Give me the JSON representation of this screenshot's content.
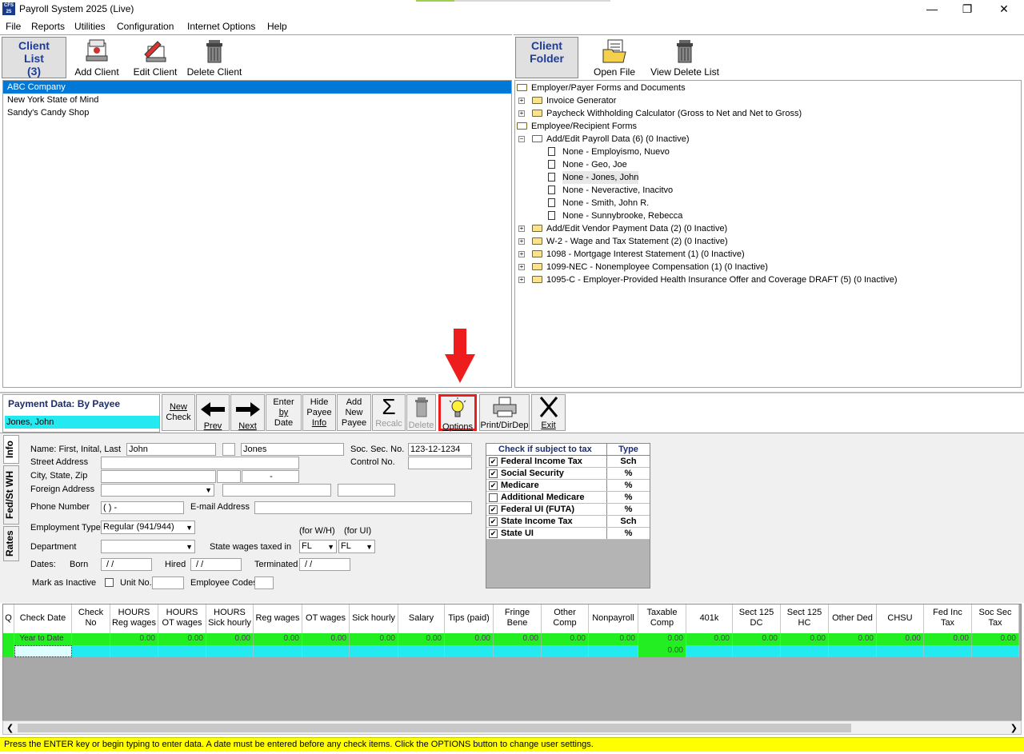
{
  "window": {
    "title": "Payroll System 2025 (Live)",
    "icon_label": "CFS 25"
  },
  "menu": [
    "File",
    "Reports",
    "Utilities",
    "Configuration",
    "Internet Options",
    "Help"
  ],
  "client_toolbar": {
    "client_list_label": "Client List (3)",
    "client_list_l1": "Client",
    "client_list_l2": "List",
    "client_list_l3": "(3)",
    "add_client": "Add Client",
    "edit_client": "Edit Client",
    "delete_client": "Delete Client"
  },
  "folder_toolbar": {
    "client_folder_l1": "Client",
    "client_folder_l2": "Folder",
    "open_file": "Open File",
    "view_delete_list": "View Delete List"
  },
  "clients": [
    "ABC Company",
    "New York State of Mind",
    "Sandy's Candy Shop"
  ],
  "tree": [
    {
      "level": 0,
      "type": "open-folder",
      "label": "Employer/Payer Forms and Documents"
    },
    {
      "level": 1,
      "type": "folder",
      "label": "Invoice Generator"
    },
    {
      "level": 1,
      "type": "folder",
      "label": "Paycheck Withholding Calculator (Gross to Net and Net to Gross)"
    },
    {
      "level": 0,
      "type": "open-folder",
      "label": "Employee/Recipient Forms"
    },
    {
      "level": 1,
      "type": "open-folder",
      "label": "Add/Edit Payroll Data  (6) (0 Inactive)"
    },
    {
      "level": 2,
      "type": "doc",
      "label": "None - Employismo, Nuevo"
    },
    {
      "level": 2,
      "type": "doc",
      "label": "None - Geo, Joe"
    },
    {
      "level": 2,
      "type": "doc",
      "label": "None - Jones, John"
    },
    {
      "level": 2,
      "type": "doc",
      "label": "None - Neveractive, Inacitvo"
    },
    {
      "level": 2,
      "type": "doc",
      "label": "None - Smith, John R."
    },
    {
      "level": 2,
      "type": "doc",
      "label": "None - Sunnybrooke, Rebecca"
    },
    {
      "level": 1,
      "type": "folder",
      "label": "Add/Edit Vendor Payment Data  (2) (0 Inactive)"
    },
    {
      "level": 1,
      "type": "folder",
      "label": "W-2 - Wage and Tax Statement  (2) (0 Inactive)"
    },
    {
      "level": 1,
      "type": "folder",
      "label": "1098 - Mortgage Interest Statement  (1) (0 Inactive)"
    },
    {
      "level": 1,
      "type": "folder",
      "label": "1099-NEC - Nonemployee Compensation  (1) (0 Inactive)"
    },
    {
      "level": 1,
      "type": "folder",
      "label": "1095-C - Employer-Provided Health Insurance Offer and Coverage DRAFT  (5) (0 Inactive)"
    }
  ],
  "payment": {
    "header": "Payment Data: By Payee",
    "payee": "Jones, John",
    "buttons": {
      "new_check_1": "New",
      "new_check_2": "Check",
      "prev": "Prev",
      "next": "Next",
      "enter_1": "Enter",
      "enter_2": "by",
      "enter_3": "Date",
      "hide_1": "Hide",
      "hide_2": "Payee",
      "hide_3": "Info",
      "add_1": "Add",
      "add_2": "New",
      "add_3": "Payee",
      "recalc": "Recalc",
      "delete": "Delete",
      "options": "Options",
      "print": "Print/DirDep",
      "exit": "Exit"
    }
  },
  "tabs": [
    "Info",
    "Fed/St WH",
    "Rates"
  ],
  "form": {
    "name_label": "Name: First, Inital, Last",
    "first": "John",
    "initial": "",
    "last": "Jones",
    "ssn_label": "Soc. Sec. No.",
    "ssn": "123-12-1234",
    "street_label": "Street Address",
    "control_label": "Control No.",
    "city_label": "City, State, Zip",
    "zip_dash": "-",
    "foreign_label": "Foreign Address",
    "phone_label": "Phone Number",
    "phone": "(   )    -",
    "email_label": "E-mail Address",
    "emp_type_label": "Employment Type",
    "emp_type": "Regular (941/944)",
    "dept_label": "Department",
    "state_wages_label": "State wages taxed in",
    "for_wh": "(for W/H)",
    "for_ui": "(for UI)",
    "state_wh": "FL",
    "state_ui": "FL",
    "dates_label": "Dates:",
    "born_label": "Born",
    "born": "/  /",
    "hired_label": "Hired",
    "hired": "/  /",
    "terminated_label": "Terminated",
    "terminated": "/  /",
    "inactive_label": "Mark as Inactive",
    "unit_label": "Unit No.",
    "emp_codes_label": "Employee Codes"
  },
  "tax_table": {
    "head_tax": "Check if subject to tax",
    "head_type": "Type",
    "rows": [
      {
        "name": "Federal Income Tax",
        "checked": true,
        "type": "Sch"
      },
      {
        "name": "Social Security",
        "checked": true,
        "type": "%"
      },
      {
        "name": "Medicare",
        "checked": true,
        "type": "%"
      },
      {
        "name": "Additional Medicare",
        "checked": false,
        "type": "%"
      },
      {
        "name": "Federal UI (FUTA)",
        "checked": true,
        "type": "%"
      },
      {
        "name": "State Income Tax",
        "checked": true,
        "type": "Sch"
      },
      {
        "name": "State UI",
        "checked": true,
        "type": "%"
      }
    ]
  },
  "grid": {
    "columns": [
      {
        "l1": "Q",
        "l2": ""
      },
      {
        "l1": "Check Date",
        "l2": ""
      },
      {
        "l1": "Check",
        "l2": "No"
      },
      {
        "l1": "HOURS",
        "l2": "Reg wages"
      },
      {
        "l1": "HOURS",
        "l2": "OT wages"
      },
      {
        "l1": "HOURS",
        "l2": "Sick hourly"
      },
      {
        "l1": "Reg wages",
        "l2": ""
      },
      {
        "l1": "OT wages",
        "l2": ""
      },
      {
        "l1": "Sick hourly",
        "l2": ""
      },
      {
        "l1": "Salary",
        "l2": ""
      },
      {
        "l1": "Tips (paid)",
        "l2": ""
      },
      {
        "l1": "Fringe",
        "l2": "Bene"
      },
      {
        "l1": "Other",
        "l2": "Comp"
      },
      {
        "l1": "Nonpayroll",
        "l2": ""
      },
      {
        "l1": "Taxable",
        "l2": "Comp"
      },
      {
        "l1": "401k",
        "l2": ""
      },
      {
        "l1": "Sect 125",
        "l2": "DC"
      },
      {
        "l1": "Sect 125",
        "l2": "HC"
      },
      {
        "l1": "Other Ded",
        "l2": ""
      },
      {
        "l1": "CHSU",
        "l2": ""
      },
      {
        "l1": "Fed Inc",
        "l2": "Tax"
      },
      {
        "l1": "Soc Sec",
        "l2": "Tax"
      }
    ],
    "ytd_label": "Year to Date",
    "zero": "0.00",
    "new_row_taxable": "0.00"
  },
  "status_bar": "Press the ENTER key or begin typing to enter data.  A date must be entered before any check items.  Click the OPTIONS button to change user settings.",
  "colors": {
    "accent_red": "#ee1c1c",
    "selection": "#0078d7",
    "ytd_green": "#22ee22",
    "new_row_cyan": "#22eaf0",
    "status_yellow": "#ffff00"
  }
}
